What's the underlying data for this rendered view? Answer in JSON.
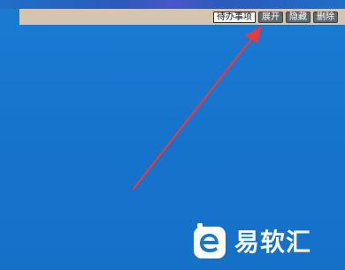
{
  "toolbar": {
    "todo_label": "待办事项",
    "expand_label": "展开",
    "hide_label": "隐藏",
    "delete_label": "删除"
  },
  "watermark": {
    "text": "易软汇"
  },
  "colors": {
    "desktop": "#1877cf",
    "toolbar": "#d4c4b0",
    "arrow": "#e83a3a"
  },
  "icons": {
    "arrow": "annotation-arrow",
    "logo": "site-logo"
  }
}
